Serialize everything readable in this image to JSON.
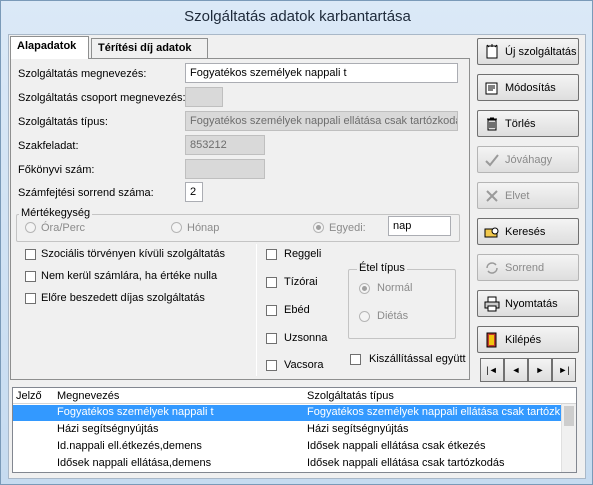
{
  "window": {
    "title": "Szolgáltatás adatok karbantartása"
  },
  "tabs": [
    {
      "label": "Alapadatok"
    },
    {
      "label": "Térítési díj adatok"
    }
  ],
  "form": {
    "name_label": "Szolgáltatás megnevezés:",
    "name_value": "Fogyatékos személyek nappali t",
    "group_label": "Szolgáltatás csoport megnevezés:",
    "group_value": "",
    "type_label": "Szolgáltatás típus:",
    "type_value": "Fogyatékos személyek nappali ellátása csak tartózkodás",
    "szakfeladat_label": "Szakfeladat:",
    "szakfeladat_value": "853212",
    "fokonyv_label": "Főkönyvi szám:",
    "fokonyv_value": "",
    "sorrend_label": "Számfejtési sorrend száma:",
    "sorrend_value": "2"
  },
  "unit": {
    "title": "Mértékegység",
    "opt1": "Óra/Perc",
    "opt2": "Hónap",
    "opt3": "Egyedi:",
    "custom_value": "nap",
    "selected": "Egyedi:"
  },
  "checks": {
    "szoc": "Szociális törvényen kívüli szolgáltatás",
    "nem": "Nem kerül számlára, ha értéke nulla",
    "elore": "Előre beszedett díjas szolgáltatás"
  },
  "meals": {
    "reggeli": "Reggeli",
    "tizorai": "Tízórai",
    "ebed": "Ebéd",
    "uzsonna": "Uzsonna",
    "vacsora": "Vacsora"
  },
  "meal_type": {
    "title": "Étel típus",
    "normal": "Normál",
    "dietas": "Diétás",
    "selected": "Normál"
  },
  "delivery": "Kiszállítással együtt",
  "buttons": {
    "uj": "Új szolgáltatás",
    "modositas": "Módosítás",
    "torles": "Törlés",
    "jovahagy": "Jóváhagy",
    "elvet": "Elvet",
    "kereses": "Keresés",
    "sorrend": "Sorrend",
    "nyomtatas": "Nyomtatás",
    "kilepes": "Kilépés"
  },
  "nav": [
    "|◄",
    "◄",
    "►",
    "►|"
  ],
  "list": {
    "headers": [
      "Jelző",
      "Megnevezés",
      "Szolgáltatás típus"
    ],
    "rows": [
      {
        "jelzo": "",
        "nev": "Fogyatékos személyek nappali t",
        "tipus": "Fogyatékos személyek nappali ellátása csak tartózkodás"
      },
      {
        "jelzo": "",
        "nev": "Házi segítségnyújtás",
        "tipus": "Házi segítségnyújtás"
      },
      {
        "jelzo": "",
        "nev": "Id.nappali ell.étkezés,demens",
        "tipus": "Idősek nappali ellátása csak étkezés"
      },
      {
        "jelzo": "",
        "nev": "Idősek nappali ellátása,demens",
        "tipus": "Idősek nappali ellátása csak tartózkodás"
      }
    ],
    "selected_row": 0
  },
  "colors": {
    "selection": "#3399ff",
    "window_bg": "#cfe1f2"
  }
}
